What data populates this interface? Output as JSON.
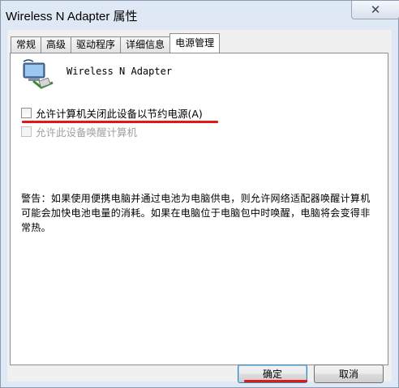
{
  "window": {
    "title": "Wireless N Adapter 属性",
    "close_glyph": "✕"
  },
  "tabs": [
    "常规",
    "高级",
    "驱动程序",
    "详细信息",
    "电源管理"
  ],
  "active_tab_index": 4,
  "device": {
    "name": "Wireless N Adapter",
    "icon": "network-adapter-icon"
  },
  "options": {
    "allow_power_off": {
      "label": "允许计算机关闭此设备以节约电源(A)",
      "checked": false,
      "enabled": true
    },
    "allow_wake": {
      "label": "允许此设备唤醒计算机",
      "checked": false,
      "enabled": false
    }
  },
  "warning": "警告：如果使用便携电脑并通过电池为电脑供电，则允许网络适配器唤醒计算机可能会加快电池电量的消耗。如果在电脑位于电脑包中时唤醒，电脑将会变得非常热。",
  "buttons": {
    "ok": "确定",
    "cancel": "取消"
  },
  "colors": {
    "annotation_underline": "#e01818",
    "window_frame": "#dfe9f5"
  }
}
